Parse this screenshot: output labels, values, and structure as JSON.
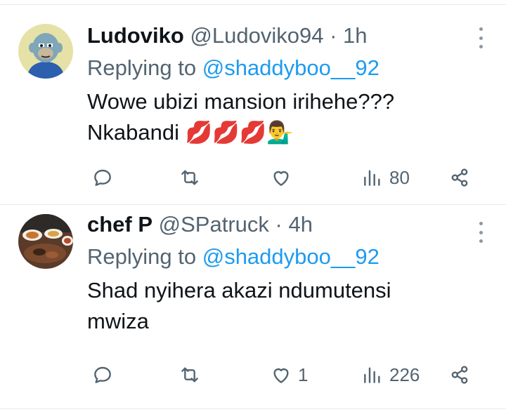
{
  "tweets": [
    {
      "name": "Ludoviko",
      "handle": "@Ludoviko94",
      "separator": "·",
      "time": "1h",
      "replying_prefix": "Replying to",
      "replying_to": "@shaddyboo__92",
      "text_line1": "Wowe ubizi mansion irihehe???",
      "text_line2": "Nkabandi 💋💋💋💁‍♂️",
      "replies": "",
      "retweets": "",
      "likes": "",
      "views": "80"
    },
    {
      "name": "chef P",
      "handle": "@SPatruck",
      "separator": "·",
      "time": "4h",
      "replying_prefix": "Replying to",
      "replying_to": "@shaddyboo__92",
      "text_line1": "Shad nyihera akazi ndumutensi",
      "text_line2": "mwiza",
      "replies": "",
      "retweets": "",
      "likes": "1",
      "views": "226"
    }
  ],
  "colors": {
    "text": "#0f1419",
    "muted": "#536471",
    "link": "#1d9bf0",
    "divider": "#e6e9ec"
  }
}
